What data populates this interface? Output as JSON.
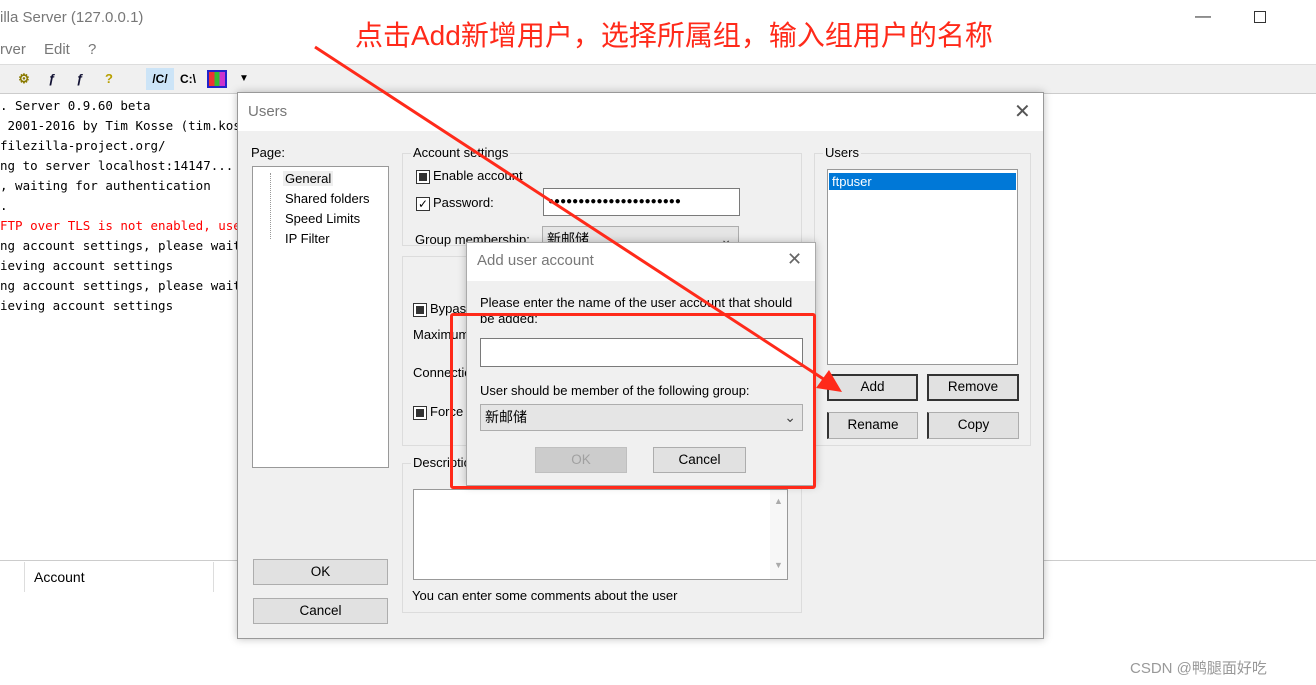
{
  "main_window": {
    "title": "illa Server (127.0.0.1)",
    "menu": [
      "rver",
      "Edit",
      "?"
    ],
    "toolbar": {
      "buttons": [
        "settings-icon",
        "user-icon",
        "group-icon",
        "help-icon"
      ],
      "path_buttons": [
        "/C/",
        "C:\\"
      ]
    },
    "log_lines": [
      {
        "text": ". Server 0.9.60 beta",
        "color": "#000000"
      },
      {
        "text": " 2001-2016 by Tim Kosse (tim.kos",
        "color": "#000000"
      },
      {
        "text": "filezilla-project.org/",
        "color": "#000000"
      },
      {
        "text": "ng to server localhost:14147...",
        "color": "#000000"
      },
      {
        "text": ", waiting for authentication",
        "color": "#000000"
      },
      {
        "text": ".",
        "color": "#000000"
      },
      {
        "text": "FTP over TLS is not enabled, use",
        "color": "#ff0000"
      },
      {
        "text": "ng account settings, please wait.",
        "color": "#000000"
      },
      {
        "text": "ieving account settings",
        "color": "#000000"
      },
      {
        "text": "ng account settings, please wait.",
        "color": "#000000"
      },
      {
        "text": "ieving account settings",
        "color": "#000000"
      }
    ],
    "bottom_column": "Account"
  },
  "annotation": {
    "text": "点击Add新增用户，选择所属组，输入组用户的名称",
    "color": "#ff2a1a"
  },
  "users_dialog": {
    "title": "Users",
    "page_label": "Page:",
    "pages": [
      "General",
      "Shared folders",
      "Speed Limits",
      "IP Filter"
    ],
    "selected_page": "General",
    "ok": "OK",
    "cancel": "Cancel",
    "account_settings": {
      "label": "Account settings",
      "enable_account": "Enable account",
      "password_label": "Password:",
      "password_value": "●●●●●●●●●●●●●●●●●●●●●●",
      "group_label": "Group membership:",
      "group_value": "新邮储"
    },
    "other": {
      "bypass": "Bypas",
      "maximum": "Maximum",
      "connections": "Connectio",
      "force": "Force"
    },
    "description": {
      "label": "Description",
      "hint": "You can enter some comments about the user"
    },
    "users": {
      "label": "Users",
      "list": [
        "ftpuser"
      ],
      "selected": "ftpuser",
      "add": "Add",
      "remove": "Remove",
      "rename": "Rename",
      "copy": "Copy"
    }
  },
  "add_user_dialog": {
    "title": "Add user account",
    "prompt": "Please enter the name of the user account that should be added:",
    "name_value": "",
    "group_prompt": "User should be member of the following group:",
    "group_value": "新邮储",
    "ok": "OK",
    "cancel": "Cancel"
  },
  "watermark": "CSDN @鸭腿面好吃"
}
